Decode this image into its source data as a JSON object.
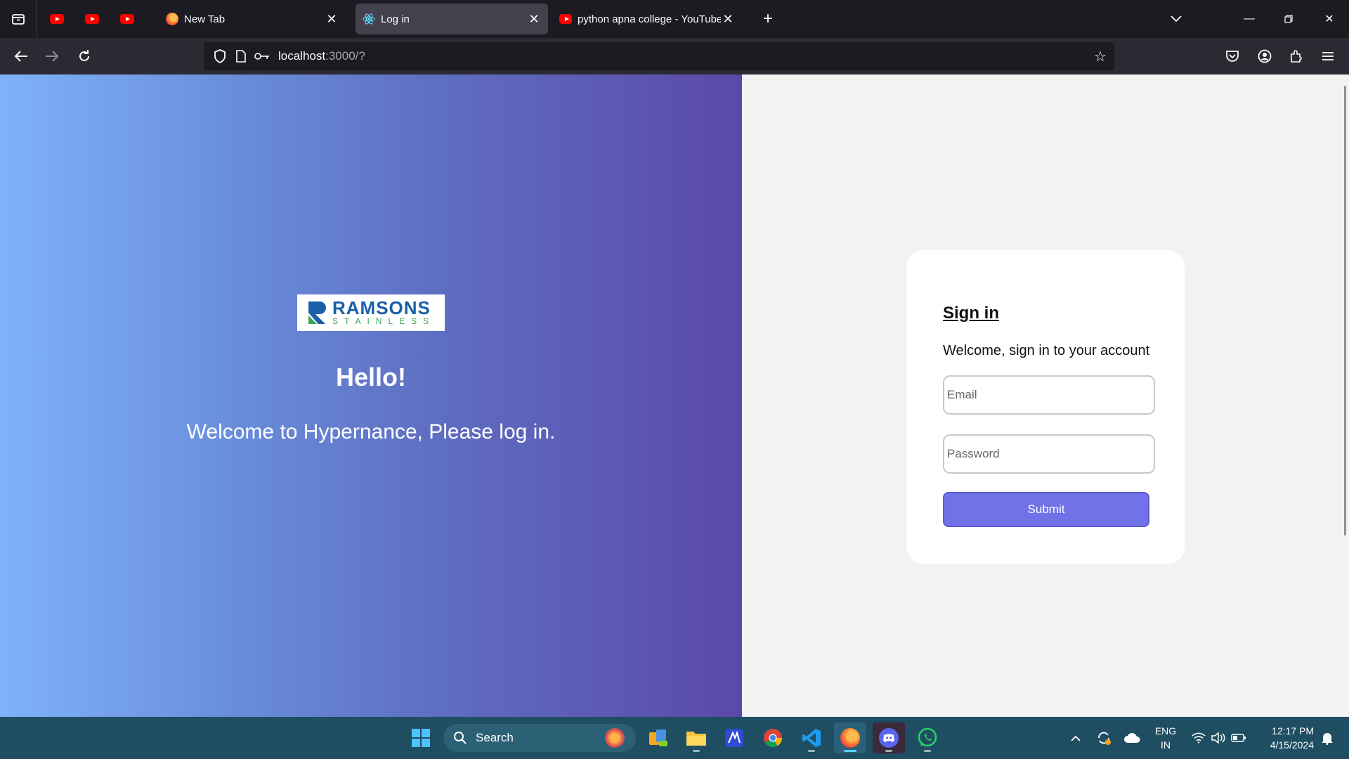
{
  "browser": {
    "tabs": [
      {
        "title": "New Tab",
        "favicon": "firefox-icon"
      },
      {
        "title": "Log in",
        "favicon": "react-icon",
        "active": true
      },
      {
        "title": "python apna college - YouTube",
        "favicon": "youtube-icon"
      }
    ],
    "pinned_tabs": [
      "youtube-icon",
      "youtube-icon",
      "youtube-icon"
    ],
    "url_host": "localhost",
    "url_path": ":3000/?"
  },
  "page": {
    "logo": {
      "main": "RAMSONS",
      "sub": "STAINLESS"
    },
    "hello": "Hello!",
    "welcome": "Welcome to Hypernance, Please log in.",
    "card": {
      "title": "Sign in",
      "subtitle": "Welcome, sign in to your account",
      "email_placeholder": "Email",
      "password_placeholder": "Password",
      "submit_label": "Submit"
    },
    "colors": {
      "submit": "#7272e8",
      "gradient_start": "#7fb2fb",
      "gradient_end": "#5b48a9"
    }
  },
  "taskbar": {
    "search_label": "Search",
    "lang_top": "ENG",
    "lang_bottom": "IN",
    "time": "12:17 PM",
    "date": "4/15/2024"
  }
}
